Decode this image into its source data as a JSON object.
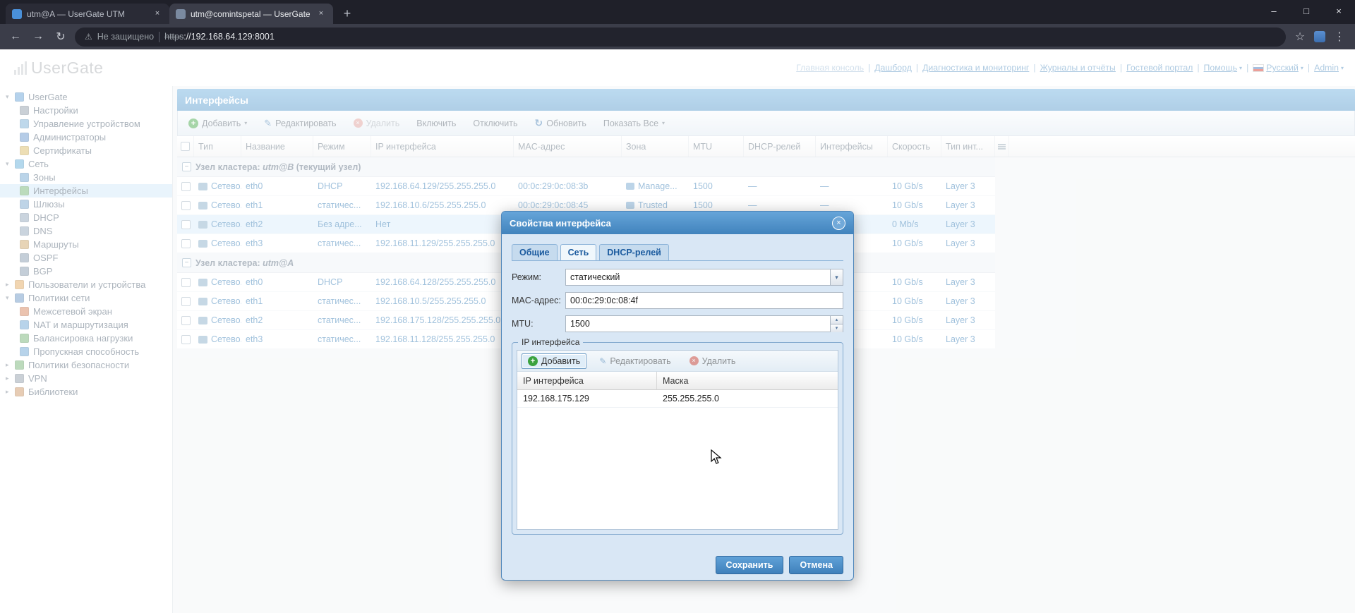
{
  "browser": {
    "tabs": [
      {
        "title": "utm@A — UserGate UTM",
        "active": false
      },
      {
        "title": "utm@comintspetal — UserGate",
        "active": true
      }
    ],
    "address": {
      "security_label": "Не защищено",
      "url_scheme": "https",
      "url_rest": "://192.168.64.129:8001"
    }
  },
  "header": {
    "logo": "UserGate",
    "nav": [
      {
        "label": "Главная консоль",
        "current": true
      },
      {
        "label": "Дашборд"
      },
      {
        "label": "Диагностика и мониторинг"
      },
      {
        "label": "Журналы и отчёты"
      },
      {
        "label": "Гостевой портал"
      },
      {
        "label": "Помощь",
        "dropdown": true
      },
      {
        "label": "Русский",
        "dropdown": true,
        "flag": true
      },
      {
        "label": "Admin",
        "dropdown": true
      }
    ]
  },
  "sidebar": {
    "items": [
      {
        "label": "UserGate",
        "depth": 0,
        "expanded": true,
        "icon": "usergate-node-icon",
        "color": "#5b9bd5"
      },
      {
        "label": "Настройки",
        "depth": 1,
        "icon": "settings-gear-icon",
        "color": "#8a97a5"
      },
      {
        "label": "Управление устройством",
        "depth": 1,
        "icon": "device-management-icon",
        "color": "#6fa8d2"
      },
      {
        "label": "Администраторы",
        "depth": 1,
        "icon": "administrators-icon",
        "color": "#5b8fc9"
      },
      {
        "label": "Сертификаты",
        "depth": 1,
        "icon": "certificates-icon",
        "color": "#d8b55a"
      },
      {
        "label": "Сеть",
        "depth": 0,
        "expanded": true,
        "icon": "network-section-icon",
        "color": "#58a8d8"
      },
      {
        "label": "Зоны",
        "depth": 1,
        "icon": "zones-icon",
        "color": "#67a0cf"
      },
      {
        "label": "Интерфейсы",
        "depth": 1,
        "selected": true,
        "icon": "interfaces-icon",
        "color": "#69b06b"
      },
      {
        "label": "Шлюзы",
        "depth": 1,
        "icon": "gateways-icon",
        "color": "#6f9fca"
      },
      {
        "label": "DHCP",
        "depth": 1,
        "icon": "dhcp-icon",
        "color": "#8aa0b5"
      },
      {
        "label": "DNS",
        "depth": 1,
        "icon": "dns-icon",
        "color": "#8aa0b5"
      },
      {
        "label": "Маршруты",
        "depth": 1,
        "icon": "routes-icon",
        "color": "#c9a05e"
      },
      {
        "label": "OSPF",
        "depth": 1,
        "icon": "ospf-icon",
        "color": "#7d93a8"
      },
      {
        "label": "BGP",
        "depth": 1,
        "icon": "bgp-icon",
        "color": "#7d93a8"
      },
      {
        "label": "Пользователи и устройства",
        "depth": 0,
        "expanded": false,
        "icon": "users-devices-icon",
        "color": "#e0a352"
      },
      {
        "label": "Политики сети",
        "depth": 0,
        "expanded": true,
        "icon": "network-policies-icon",
        "color": "#5f8fc0"
      },
      {
        "label": "Межсетевой экран",
        "depth": 1,
        "icon": "firewall-icon",
        "color": "#d27a4f"
      },
      {
        "label": "NAT и маршрутизация",
        "depth": 1,
        "icon": "nat-routing-icon",
        "color": "#5f9ed0"
      },
      {
        "label": "Балансировка нагрузки",
        "depth": 1,
        "icon": "load-balancing-icon",
        "color": "#6aae6c"
      },
      {
        "label": "Пропускная способность",
        "depth": 1,
        "icon": "bandwidth-icon",
        "color": "#5f9ed0"
      },
      {
        "label": "Политики безопасности",
        "depth": 0,
        "expanded": false,
        "icon": "security-policies-icon",
        "color": "#6aae6c"
      },
      {
        "label": "VPN",
        "depth": 0,
        "expanded": false,
        "icon": "vpn-icon",
        "color": "#8a97a5"
      },
      {
        "label": "Библиотеки",
        "depth": 0,
        "expanded": false,
        "icon": "libraries-icon",
        "color": "#c98f5a"
      }
    ]
  },
  "main": {
    "title": "Интерфейсы",
    "toolbar": [
      {
        "label": "Добавить",
        "name": "add-button",
        "icon": "add-icon",
        "dropdown": true,
        "disabled": false
      },
      {
        "label": "Редактировать",
        "name": "edit-button",
        "icon": "edit-icon",
        "disabled": false
      },
      {
        "label": "Удалить",
        "name": "delete-button",
        "icon": "delete-icon",
        "disabled": true
      },
      {
        "label": "Включить",
        "name": "enable-button",
        "disabled": false
      },
      {
        "label": "Отключить",
        "name": "disable-button",
        "disabled": false
      },
      {
        "label": "Обновить",
        "name": "refresh-button",
        "icon": "refresh-icon",
        "disabled": false
      },
      {
        "label": "Показать Все",
        "name": "show-all-button",
        "dropdown": true,
        "disabled": false
      }
    ],
    "grid": {
      "columns": [
        "Тип",
        "Название",
        "Режим",
        "IP интерфейса",
        "MAC-адрес",
        "Зона",
        "MTU",
        "DHCP-релей",
        "Интерфейсы",
        "Скорость",
        "Тип инт..."
      ],
      "groups": [
        {
          "prefix": "Узел кластера:",
          "node": "utm@B",
          "suffix": "(текущий узел)",
          "rows": [
            {
              "cells": [
                "Сетево...",
                "eth0",
                "DHCP",
                "192.168.64.129/255.255.255.0",
                "00:0c:29:0c:08:3b",
                "Manage...",
                "1500",
                "—",
                "—",
                "10 Gb/s",
                "Layer 3"
              ]
            },
            {
              "cells": [
                "Сетево...",
                "eth1",
                "статичес...",
                "192.168.10.6/255.255.255.0",
                "00:0c:29:0c:08:45",
                "Trusted",
                "1500",
                "—",
                "—",
                "10 Gb/s",
                "Layer 3"
              ]
            },
            {
              "cells": [
                "Сетево...",
                "eth2",
                "Без адре...",
                "Нет",
                "",
                "",
                "",
                "",
                "",
                "0 Mb/s",
                "Layer 3"
              ],
              "selected": true
            },
            {
              "cells": [
                "Сетево...",
                "eth3",
                "статичес...",
                "192.168.11.129/255.255.255.0",
                "",
                "",
                "",
                "",
                "",
                "10 Gb/s",
                "Layer 3"
              ]
            }
          ]
        },
        {
          "prefix": "Узел кластера:",
          "node": "utm@A",
          "suffix": "",
          "rows": [
            {
              "cells": [
                "Сетево...",
                "eth0",
                "DHCP",
                "192.168.64.128/255.255.255.0",
                "",
                "",
                "",
                "",
                "",
                "10 Gb/s",
                "Layer 3"
              ]
            },
            {
              "cells": [
                "Сетево...",
                "eth1",
                "статичес...",
                "192.168.10.5/255.255.255.0",
                "",
                "",
                "",
                "",
                "",
                "10 Gb/s",
                "Layer 3"
              ]
            },
            {
              "cells": [
                "Сетево...",
                "eth2",
                "статичес...",
                "192.168.175.128/255.255.255.0",
                "",
                "",
                "",
                "",
                "",
                "10 Gb/s",
                "Layer 3"
              ]
            },
            {
              "cells": [
                "Сетево...",
                "eth3",
                "статичес...",
                "192.168.11.128/255.255.255.0",
                "",
                "",
                "",
                "",
                "",
                "10 Gb/s",
                "Layer 3"
              ]
            }
          ]
        }
      ]
    }
  },
  "dialog": {
    "title": "Свойства интерфейса",
    "tabs": [
      {
        "label": "Общие",
        "active": false
      },
      {
        "label": "Сеть",
        "active": true
      },
      {
        "label": "DHCP-релей",
        "active": false
      }
    ],
    "form": {
      "mode_label": "Режим:",
      "mode_value": "статический",
      "mac_label": "MAC-адрес:",
      "mac_value": "00:0c:29:0c:08:4f",
      "mtu_label": "MTU:",
      "mtu_value": "1500"
    },
    "ip_section": {
      "legend": "IP интерфейса",
      "toolbar": {
        "add": "Добавить",
        "edit": "Редактировать",
        "delete": "Удалить"
      },
      "columns": {
        "ip": "IP интерфейса",
        "mask": "Маска"
      },
      "rows": [
        {
          "ip": "192.168.175.129",
          "mask": "255.255.255.0"
        }
      ]
    },
    "buttons": {
      "save": "Сохранить",
      "cancel": "Отмена"
    }
  }
}
